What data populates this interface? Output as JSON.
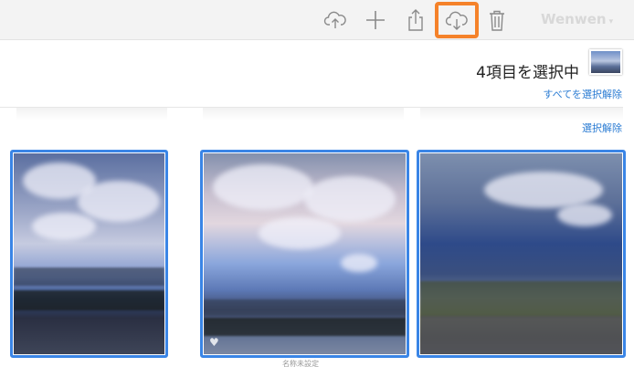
{
  "toolbar": {
    "icons": [
      "cloud-upload-icon",
      "plus-icon",
      "share-icon",
      "cloud-download-icon",
      "trash-icon"
    ],
    "highlight_color": "#f5822a",
    "account_name": "Wenwen",
    "account_caret": "▾"
  },
  "selection": {
    "count_label": "4項目を選択中",
    "deselect_all_label": "すべてを選択解除",
    "deselect_label": "選択解除"
  },
  "photos": [
    {
      "selected": true
    },
    {
      "selected": true,
      "favorite_icon": "heart-icon",
      "caption": "名称未設定"
    },
    {
      "selected": true
    }
  ],
  "colors": {
    "selection_border": "#3a85e6",
    "link": "#2b7cd3"
  }
}
